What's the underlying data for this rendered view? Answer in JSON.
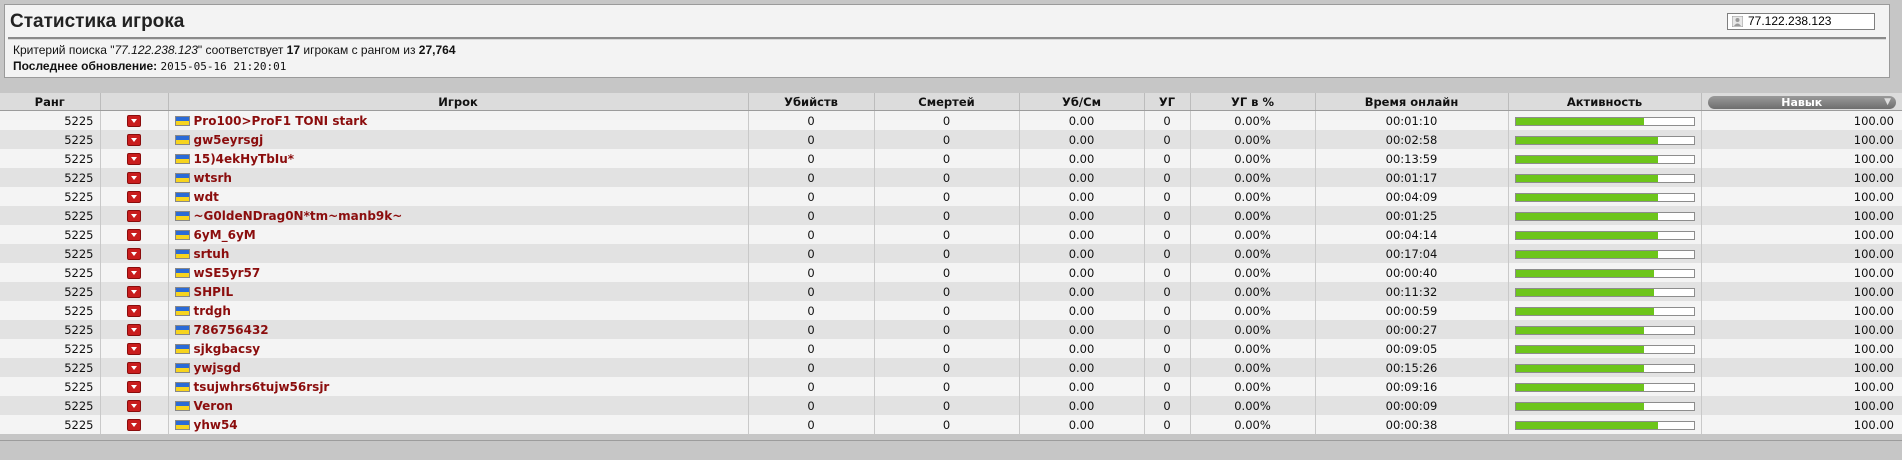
{
  "title": "Статистика игрока",
  "search": {
    "value": "77.122.238.123"
  },
  "info": {
    "prefix": "Критерий поиска \"",
    "query": "77.122.238.123",
    "middle": "\" соответствует ",
    "count": "17",
    "middle2": " игрокам с рангом из ",
    "total": "27,764",
    "updated_label": "Последнее обновление:",
    "updated_value": "2015-05-16 21:20:01"
  },
  "columns": {
    "rank": "Ранг",
    "player": "Игрок",
    "kills": "Убийств",
    "deaths": "Смертей",
    "kd": "Уб/См",
    "hs": "УГ",
    "hs_pct": "УГ в %",
    "time": "Время онлайн",
    "activity": "Активность",
    "skill": "Навык"
  },
  "colors": {
    "activity_bar": "#6dc51b",
    "player_name": "#8b0d0d"
  },
  "rows": [
    {
      "rank": "5225",
      "name": "Pro100>ProF1 TONI stark",
      "kills": "0",
      "deaths": "0",
      "kd": "0.00",
      "hs": "0",
      "hs_pct": "0.00%",
      "time": "00:01:10",
      "activity": 0.72,
      "skill": "100.00"
    },
    {
      "rank": "5225",
      "name": "gw5eyrsgj",
      "kills": "0",
      "deaths": "0",
      "kd": "0.00",
      "hs": "0",
      "hs_pct": "0.00%",
      "time": "00:02:58",
      "activity": 0.8,
      "skill": "100.00"
    },
    {
      "rank": "5225",
      "name": "15)4ekHyTbIu*",
      "kills": "0",
      "deaths": "0",
      "kd": "0.00",
      "hs": "0",
      "hs_pct": "0.00%",
      "time": "00:13:59",
      "activity": 0.8,
      "skill": "100.00"
    },
    {
      "rank": "5225",
      "name": "wtsrh",
      "kills": "0",
      "deaths": "0",
      "kd": "0.00",
      "hs": "0",
      "hs_pct": "0.00%",
      "time": "00:01:17",
      "activity": 0.8,
      "skill": "100.00"
    },
    {
      "rank": "5225",
      "name": "wdt",
      "kills": "0",
      "deaths": "0",
      "kd": "0.00",
      "hs": "0",
      "hs_pct": "0.00%",
      "time": "00:04:09",
      "activity": 0.8,
      "skill": "100.00"
    },
    {
      "rank": "5225",
      "name": "~G0ldeNDrag0N*tm~manb9k~",
      "kills": "0",
      "deaths": "0",
      "kd": "0.00",
      "hs": "0",
      "hs_pct": "0.00%",
      "time": "00:01:25",
      "activity": 0.8,
      "skill": "100.00"
    },
    {
      "rank": "5225",
      "name": "6yM_6yM",
      "kills": "0",
      "deaths": "0",
      "kd": "0.00",
      "hs": "0",
      "hs_pct": "0.00%",
      "time": "00:04:14",
      "activity": 0.8,
      "skill": "100.00"
    },
    {
      "rank": "5225",
      "name": "srtuh",
      "kills": "0",
      "deaths": "0",
      "kd": "0.00",
      "hs": "0",
      "hs_pct": "0.00%",
      "time": "00:17:04",
      "activity": 0.8,
      "skill": "100.00"
    },
    {
      "rank": "5225",
      "name": "wSE5yr57",
      "kills": "0",
      "deaths": "0",
      "kd": "0.00",
      "hs": "0",
      "hs_pct": "0.00%",
      "time": "00:00:40",
      "activity": 0.78,
      "skill": "100.00"
    },
    {
      "rank": "5225",
      "name": "SHPIL",
      "kills": "0",
      "deaths": "0",
      "kd": "0.00",
      "hs": "0",
      "hs_pct": "0.00%",
      "time": "00:11:32",
      "activity": 0.78,
      "skill": "100.00"
    },
    {
      "rank": "5225",
      "name": "trdgh",
      "kills": "0",
      "deaths": "0",
      "kd": "0.00",
      "hs": "0",
      "hs_pct": "0.00%",
      "time": "00:00:59",
      "activity": 0.78,
      "skill": "100.00"
    },
    {
      "rank": "5225",
      "name": "786756432",
      "kills": "0",
      "deaths": "0",
      "kd": "0.00",
      "hs": "0",
      "hs_pct": "0.00%",
      "time": "00:00:27",
      "activity": 0.72,
      "skill": "100.00"
    },
    {
      "rank": "5225",
      "name": "sjkgbacsy",
      "kills": "0",
      "deaths": "0",
      "kd": "0.00",
      "hs": "0",
      "hs_pct": "0.00%",
      "time": "00:09:05",
      "activity": 0.72,
      "skill": "100.00"
    },
    {
      "rank": "5225",
      "name": "ywjsgd",
      "kills": "0",
      "deaths": "0",
      "kd": "0.00",
      "hs": "0",
      "hs_pct": "0.00%",
      "time": "00:15:26",
      "activity": 0.72,
      "skill": "100.00"
    },
    {
      "rank": "5225",
      "name": "tsujwhrs6tujw56rsjr",
      "kills": "0",
      "deaths": "0",
      "kd": "0.00",
      "hs": "0",
      "hs_pct": "0.00%",
      "time": "00:09:16",
      "activity": 0.72,
      "skill": "100.00"
    },
    {
      "rank": "5225",
      "name": "Veron",
      "kills": "0",
      "deaths": "0",
      "kd": "0.00",
      "hs": "0",
      "hs_pct": "0.00%",
      "time": "00:00:09",
      "activity": 0.72,
      "skill": "100.00"
    },
    {
      "rank": "5225",
      "name": "yhw54",
      "kills": "0",
      "deaths": "0",
      "kd": "0.00",
      "hs": "0",
      "hs_pct": "0.00%",
      "time": "00:00:38",
      "activity": 0.8,
      "skill": "100.00"
    }
  ]
}
